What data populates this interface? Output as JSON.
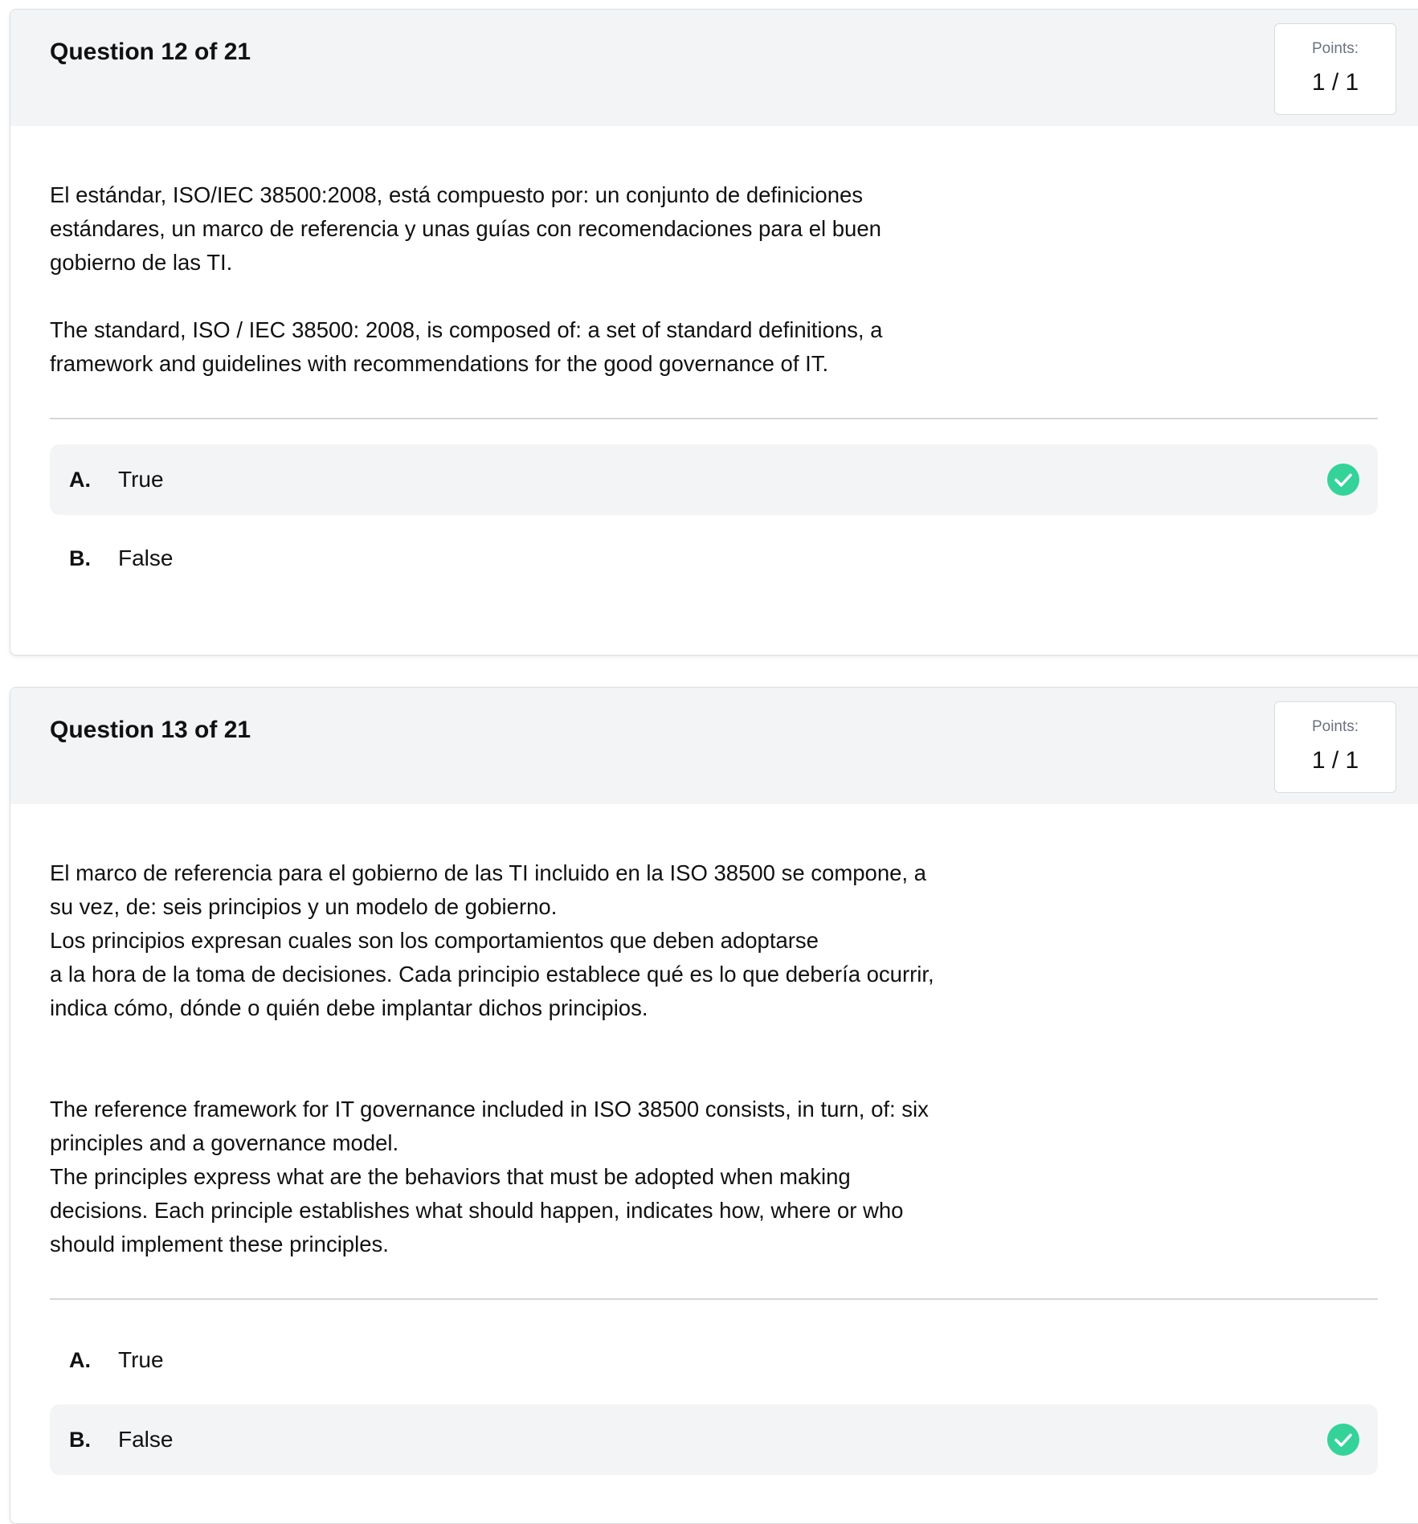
{
  "questions": [
    {
      "title": "Question 12 of 21",
      "points_label": "Points:",
      "points_value": "1 / 1",
      "paragraphs": [
        "El estándar, ISO/IEC 38500:2008, está compuesto por: un conjunto de definiciones\nestándares, un marco de referencia y unas guías con recomendaciones para el buen\ngobierno de las TI.",
        "The standard, ISO / IEC 38500: 2008, is composed of: a set of standard definitions, a\nframework and guidelines with recommendations for the good governance of IT."
      ],
      "options": [
        {
          "letter": "A.",
          "label": "True",
          "selected": true
        },
        {
          "letter": "B.",
          "label": "False",
          "selected": false
        }
      ]
    },
    {
      "title": "Question 13 of 21",
      "points_label": "Points:",
      "points_value": "1 / 1",
      "paragraphs": [
        "El marco de referencia para el gobierno de las TI incluido en la ISO 38500 se compone, a\nsu vez, de: seis principios y un modelo de gobierno.\nLos principios expresan cuales son los comportamientos que deben adoptarse\na la hora de la toma de decisiones. Cada principio establece qué es lo que debería ocurrir,\nindica cómo, dónde o quién debe implantar dichos principios.",
        "The reference framework for IT governance included in ISO 38500 consists, in turn, of: six\nprinciples and a governance model.\nThe principles express what are the behaviors that must be adopted when making\ndecisions. Each principle establishes what should happen, indicates how, where or who\nshould implement these principles."
      ],
      "options": [
        {
          "letter": "A.",
          "label": "True",
          "selected": false
        },
        {
          "letter": "B.",
          "label": "False",
          "selected": true
        }
      ]
    }
  ],
  "colors": {
    "header_bg": "#f3f4f6",
    "selected_option_bg": "#f3f4f6",
    "check_green": "#34d399",
    "text": "#111111",
    "muted": "#6b7280"
  },
  "icons": {
    "selected_marker": "check-circle-icon"
  }
}
